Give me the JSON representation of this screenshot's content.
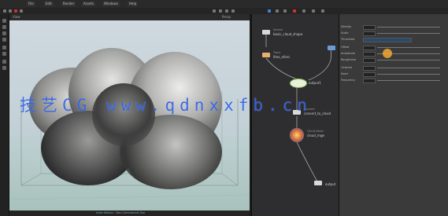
{
  "menubar": {
    "tabs": [
      "File",
      "Edit",
      "Render",
      "Assets",
      "Windows",
      "Help"
    ]
  },
  "viewport": {
    "title": "View",
    "corner_label": "Persp",
    "status_text": "Indie Edition - Non-Commercial Use"
  },
  "network": {
    "path": "/obj/cloud",
    "nodes": [
      {
        "type": "Sphere",
        "name": "basic_cloud_shape"
      },
      {
        "type": "Trans",
        "name": "litex_xforo"
      },
      {
        "type": "Null",
        "name": "output1"
      },
      {
        "type": "Convert",
        "name": "convert_to_cloud"
      },
      {
        "type": "Cloud Noise",
        "name": "cloud_rnge"
      },
      {
        "type": "Output",
        "name": "output"
      }
    ]
  },
  "parameters": {
    "node_name": "cloudlight",
    "rows": [
      "Density",
      "Scale",
      "Threshold",
      "Offset",
      "Amplitude",
      "Roughness",
      "Octaves",
      "Seed",
      "Frequency"
    ]
  },
  "watermark": "技艺CG  www.qdnxxfb.cn",
  "colors": {
    "accent": "#f0a830",
    "watermark": "#2a5ee6",
    "selected_node": "#ffd27a",
    "network_bg": "#2e2e30"
  }
}
